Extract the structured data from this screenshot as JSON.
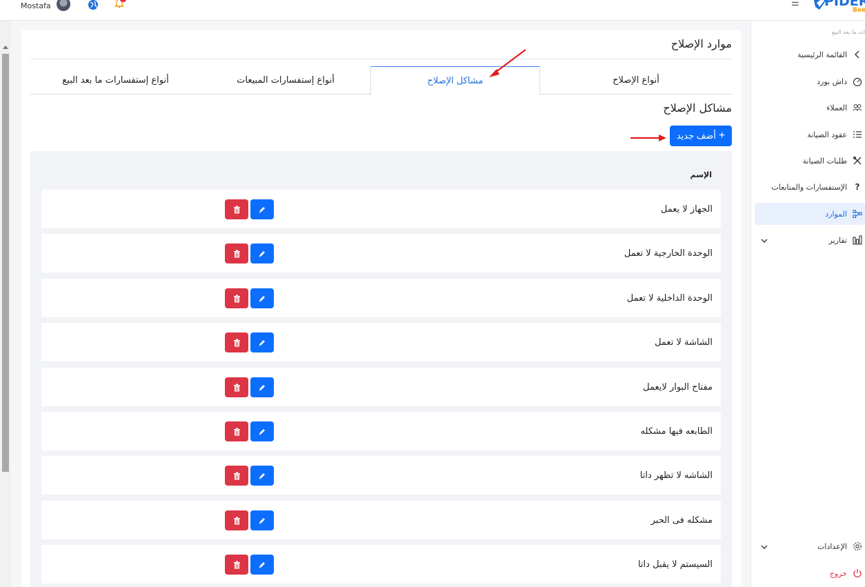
{
  "topbar": {
    "user_name": "Mostafa",
    "avatar_icon": "user-avatar",
    "globe_icon": "globe-icon",
    "bell_icon": "bell-icon",
    "menu_icon": "hamburger-icon",
    "logo_text": "PIDER",
    "logo_sub": "Bee"
  },
  "page": {
    "title": "موارد الإصلاح",
    "section_title": "مشاكل الإصلاح",
    "add_button": "أضف جديد",
    "column_name": "الإسم"
  },
  "tabs": [
    {
      "label": "أنواع الإصلاح",
      "active": false
    },
    {
      "label": "مشاكل الإصلاح",
      "active": true
    },
    {
      "label": "أنواع إستفسارات المبيعات",
      "active": false
    },
    {
      "label": "أنواع إستفسارات ما بعد البيع",
      "active": false
    }
  ],
  "rows": [
    {
      "name": "الجهاز لا يعمل"
    },
    {
      "name": "الوحدة الخارجية لا تعمل"
    },
    {
      "name": "الوحدة الداخلية لا تعمل"
    },
    {
      "name": "الشاشة لا تعمل"
    },
    {
      "name": "مفتاح البوار لايعمل"
    },
    {
      "name": "الطابعه فيها مشكله"
    },
    {
      "name": "الشاشه لا تظهر داتا"
    },
    {
      "name": "مشكله فى الحبر"
    },
    {
      "name": "السيستم لا يقبل داتا"
    }
  ],
  "sidebar": {
    "caption": "ات ما بعد البيع",
    "items": [
      {
        "label": "القائمة الرئيسية",
        "icon": "chevron-left-icon"
      },
      {
        "label": "داش بورد",
        "icon": "gauge-icon"
      },
      {
        "label": "العملاء",
        "icon": "users-icon"
      },
      {
        "label": "عقود الصيانة",
        "icon": "list-icon"
      },
      {
        "label": "طلبات الصيانة",
        "icon": "tools-icon"
      },
      {
        "label": "الإستفسارات والمتابعات",
        "icon": "question-icon"
      },
      {
        "label": "الموارد",
        "icon": "network-icon",
        "active": true
      },
      {
        "label": "تقارير",
        "icon": "bar-chart-icon"
      }
    ],
    "settings": {
      "label": "الإعدادات",
      "icon": "gear-icon"
    },
    "logout": {
      "label": "خروج",
      "icon": "power-icon"
    }
  },
  "colors": {
    "primary": "#0d6efd",
    "danger": "#dc3545",
    "annotation_arrow": "#e11d1d"
  }
}
